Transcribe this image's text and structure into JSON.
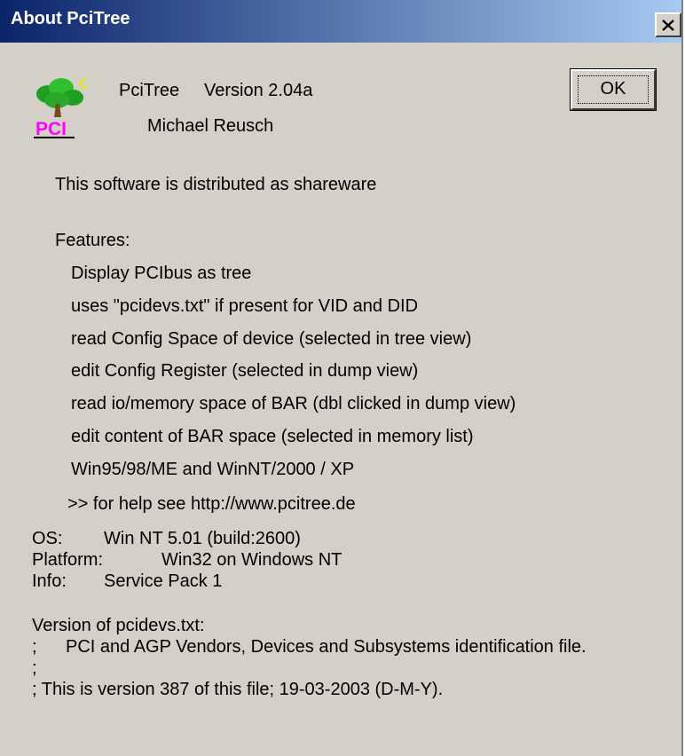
{
  "window": {
    "title": "About PciTree",
    "close_glyph": "X"
  },
  "header": {
    "app_name": "PciTree",
    "version": "Version 2.04a",
    "author": "Michael Reusch",
    "logo_text": "PCI",
    "logo_icon": "tree-icon"
  },
  "buttons": {
    "ok_label": "OK"
  },
  "body": {
    "shareware_notice": "This software is distributed as shareware",
    "features_heading": "Features:",
    "features": [
      "Display PCIbus as tree",
      "uses \"pcidevs.txt\" if present for VID and DID",
      "read Config Space of device (selected in tree view)",
      "edit Config Register (selected in dump view)",
      "read io/memory space of BAR (dbl clicked in dump view)",
      "edit content of BAR space (selected in memory list)",
      "Win95/98/ME and WinNT/2000 / XP"
    ],
    "help_link": ">> for help see http://www.pcitree.de"
  },
  "system_info": {
    "os_label": "OS:",
    "os_value": "Win NT 5.01   (build:2600)",
    "platform_label": "Platform:",
    "platform_value": "Win32 on Windows NT",
    "info_label": "Info:",
    "info_value": "Service Pack 1"
  },
  "pcidevs": {
    "heading": "Version of pcidevs.txt:",
    "line1_prefix": ";",
    "line1_text": "PCI and AGP Vendors, Devices and Subsystems identification file.",
    "line2": ";",
    "line3": "; This is version 387 of this file; 19-03-2003 (D-M-Y)."
  },
  "colors": {
    "titlebar_start": "#0a246a",
    "titlebar_end": "#a6caf0",
    "dialog_bg": "#d4d0c8",
    "logo_text": "#ff00ff",
    "tree_green": "#1f9f1f"
  }
}
